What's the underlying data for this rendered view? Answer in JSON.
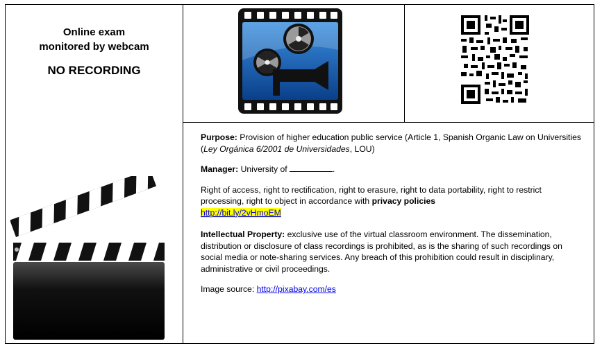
{
  "notice": {
    "line1": "Online exam",
    "line2": "monitored by webcam",
    "no_recording": "NO RECORDING"
  },
  "images": {
    "projector": "film-projector-icon",
    "qr": "qr-code",
    "clapper": "clapperboard-icon"
  },
  "info": {
    "purpose_label": "Purpose:",
    "purpose_text": "Provision of higher education public service (Article 1, Spanish Organic Law on Universities (",
    "purpose_law": "Ley Orgánica 6/2001 de Universidades",
    "purpose_end": ", LOU)",
    "manager_label": "Manager:",
    "manager_text": "University of",
    "manager_end": ".",
    "rights_text": "Right of access, right to rectification, right to erasure, right to data portability, right to restrict processing, right to object in accordance with",
    "rights_bold": "privacy policies",
    "rights_link": "http://bit.ly/2vHmoEM",
    "ip_label": "Intellectual Property:",
    "ip_text": "exclusive use of the virtual classroom environment. The dissemination, distribution or disclosure of class recordings is prohibited, as is the sharing of such recordings on social media or note-sharing services. Any breach of this prohibition could result in disciplinary, administrative or civil proceedings.",
    "source_label": "Image source:",
    "source_link": "http://pixabay.com/es"
  }
}
